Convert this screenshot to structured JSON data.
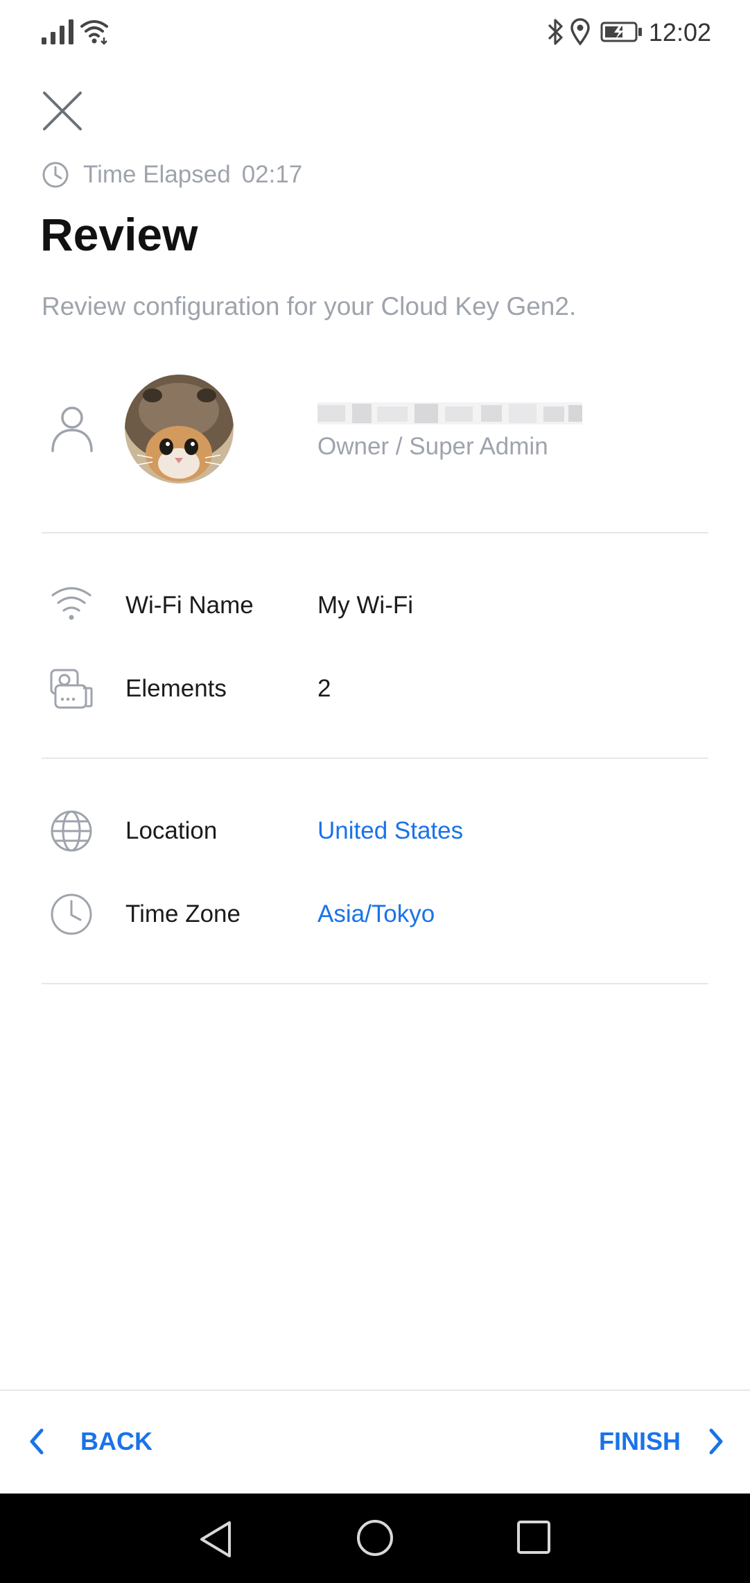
{
  "status_bar": {
    "time": "12:02"
  },
  "header": {
    "elapsed_label": "Time Elapsed",
    "elapsed_value": "02:17",
    "title": "Review",
    "subtitle": "Review configuration for your Cloud Key Gen2."
  },
  "owner": {
    "role": "Owner / Super Admin"
  },
  "network": {
    "wifi_label": "Wi-Fi Name",
    "wifi_value": "My Wi-Fi",
    "elements_label": "Elements",
    "elements_value": "2"
  },
  "locale": {
    "location_label": "Location",
    "location_value": "United States",
    "timezone_label": "Time Zone",
    "timezone_value": "Asia/Tokyo"
  },
  "footer": {
    "back_label": "BACK",
    "finish_label": "FINISH"
  },
  "colors": {
    "accent": "#1a73e8",
    "muted_text": "#9ea3ac",
    "divider": "#e6e7ea",
    "nav_bar": "#000000"
  },
  "icons": {
    "close": "close-icon",
    "elapsed": "clock-icon",
    "user": "user-icon",
    "wifi": "wifi-icon",
    "elements": "devices-icon",
    "location": "globe-icon",
    "timezone": "clock-icon"
  }
}
